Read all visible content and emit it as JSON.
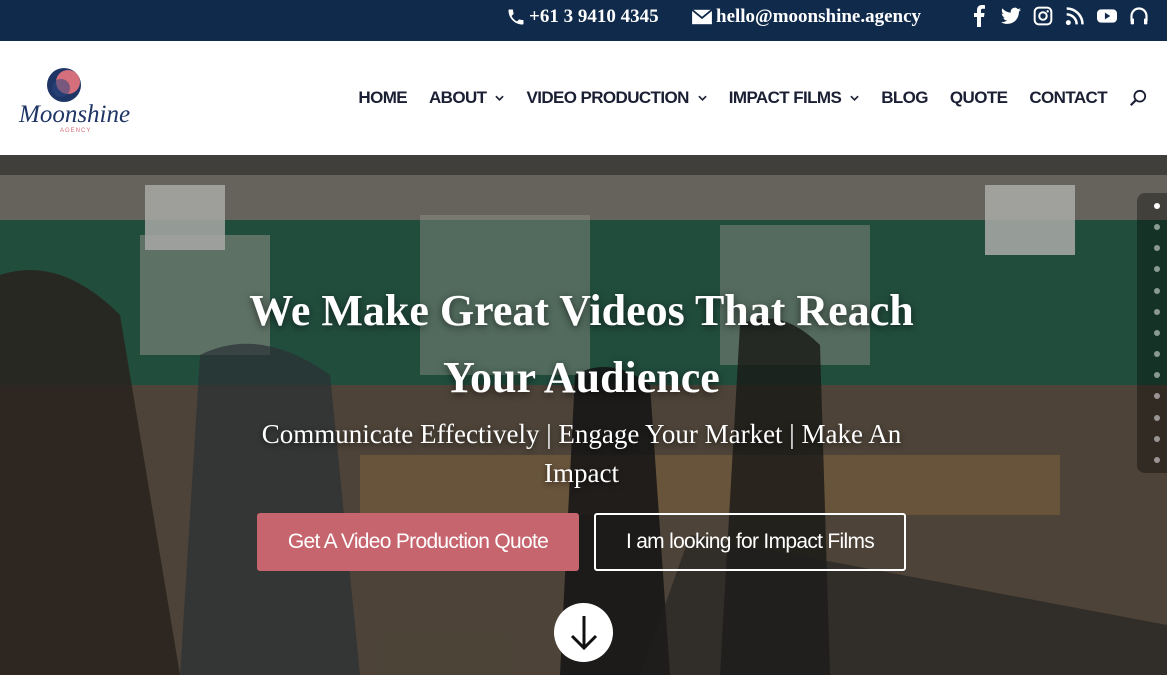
{
  "topbar": {
    "phone": "+61 3 9410 4345",
    "email": "hello@moonshine.agency",
    "social_icons": [
      "facebook-icon",
      "twitter-icon",
      "instagram-icon",
      "rss-icon",
      "youtube-icon",
      "podcast-icon"
    ]
  },
  "brand": {
    "logo_text": "Moonshine",
    "logo_subtext": "AGENCY",
    "colors": {
      "navy": "#0f2a4a",
      "rose": "#c7656f"
    }
  },
  "nav": {
    "items": [
      {
        "label": "HOME",
        "has_dropdown": false
      },
      {
        "label": "ABOUT",
        "has_dropdown": true
      },
      {
        "label": "VIDEO PRODUCTION",
        "has_dropdown": true
      },
      {
        "label": "IMPACT FILMS",
        "has_dropdown": true
      },
      {
        "label": "BLOG",
        "has_dropdown": false
      },
      {
        "label": "QUOTE",
        "has_dropdown": false
      },
      {
        "label": "CONTACT",
        "has_dropdown": false
      }
    ]
  },
  "hero": {
    "title_line1": "We Make Great Videos That Reach",
    "title_line2": "Your Audience",
    "subtitle_line1": "Communicate Effectively | Engage Your Market | Make An",
    "subtitle_line2": "Impact",
    "primary_button": "Get A Video Production Quote",
    "secondary_button": "I am looking for Impact Films"
  },
  "side_nav": {
    "count": 13,
    "active_index": 0
  }
}
